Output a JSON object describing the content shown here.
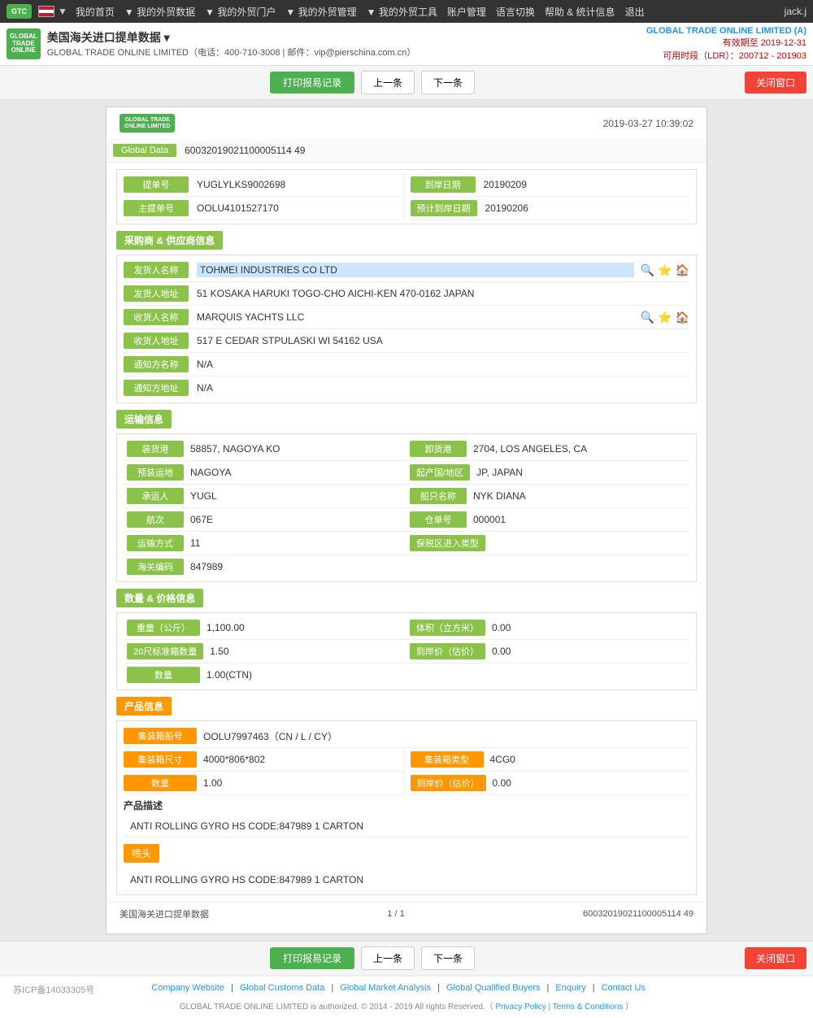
{
  "topNav": {
    "items": [
      "我的首页",
      "我的外贸数据",
      "我的外贸门户",
      "我的外贸管理",
      "我的外贸工具",
      "账户管理",
      "语言切换",
      "帮助 & 统计信息",
      "退出"
    ],
    "user": "jack.j",
    "flag": "US"
  },
  "header": {
    "title": "美国海关进口提单数据",
    "contact": "GLOBAL TRADE ONLINE LIMITED（电话：400-710-3008 | 邮件：vip@pierschina.com.cn）",
    "brand": "GLOBAL TRADE ONLINE LIMITED (A)",
    "validUntil": "有效期至 2019-12-31",
    "timeRange": "可用时段（LDR）：200712 - 201903"
  },
  "toolbar": {
    "print": "打印报易记录",
    "prev": "上一条",
    "next": "下一条",
    "close": "关闭窗口"
  },
  "record": {
    "timestamp": "2019-03-27 10:39:02",
    "globalData": {
      "label": "Global Data",
      "value": "60032019021100005114 49"
    },
    "billNo": {
      "label": "提单号",
      "value": "YUGLYLKS9002698"
    },
    "arrivalDate": {
      "label": "到岸日期",
      "value": "20190209"
    },
    "masterBillNo": {
      "label": "主提单号",
      "value": "OOLU4101527170"
    },
    "estimatedArrival": {
      "label": "预计到岸日期",
      "value": "20190206"
    }
  },
  "supplier": {
    "sectionTitle": "采购商 & 供应商信息",
    "shipper": {
      "label": "发货人名称",
      "value": "TOHMEI INDUSTRIES CO LTD"
    },
    "shipperAddr": {
      "label": "发货人地址",
      "value": "51 KOSAKA HARUKI TOGO-CHO AICHI-KEN 470-0162 JAPAN"
    },
    "consignee": {
      "label": "收货人名称",
      "value": "MARQUIS YACHTS LLC"
    },
    "consigneeAddr": {
      "label": "收货人地址",
      "value": "517 E CEDAR STPULASKI WI 54162 USA"
    },
    "notify": {
      "label": "通知方名称",
      "value": "N/A"
    },
    "notifyAddr": {
      "label": "通知方地址",
      "value": "N/A"
    }
  },
  "transport": {
    "sectionTitle": "运输信息",
    "loadPort": {
      "label": "装货港",
      "value": "58857, NAGOYA KO"
    },
    "dischargePort": {
      "label": "卸货港",
      "value": "2704, LOS ANGELES, CA"
    },
    "loadPlace": {
      "label": "预装运地",
      "value": "NAGOYA"
    },
    "originCountry": {
      "label": "起产国/地区",
      "value": "JP, JAPAN"
    },
    "carrier": {
      "label": "承运人",
      "value": "YUGL"
    },
    "vesselName": {
      "label": "船只名称",
      "value": "NYK DIANA"
    },
    "voyage": {
      "label": "航次",
      "value": "067E"
    },
    "billCount": {
      "label": "仓单号",
      "value": "000001"
    },
    "transportMode": {
      "label": "运输方式",
      "value": "11"
    },
    "bondedZone": {
      "label": "保税区进入类型",
      "value": ""
    },
    "customsCode": {
      "label": "海关编码",
      "value": "847989"
    }
  },
  "quantity": {
    "sectionTitle": "数量 & 价格信息",
    "weight": {
      "label": "重量（公斤）",
      "value": "1,100.00"
    },
    "volume": {
      "label": "体积（立方米）",
      "value": "0.00"
    },
    "containers20": {
      "label": "20尺标准箱数量",
      "value": "1.50"
    },
    "arrivalPrice": {
      "label": "到岸价（估价）",
      "value": "0.00"
    },
    "quantity": {
      "label": "数量",
      "value": "1.00(CTN)"
    }
  },
  "product": {
    "sectionTitle": "产品信息",
    "containerNo": {
      "label": "集装箱船号",
      "value": "OOLU7997463（CN / L / CY）"
    },
    "containerSize": {
      "label": "集装箱尺寸",
      "value": "4000*806*802"
    },
    "containerType": {
      "label": "集装箱类型",
      "value": "4CG0"
    },
    "quantityLabel": {
      "label": "数量",
      "value": "1.00"
    },
    "arrivalPrice": {
      "label": "到岸价（估价）",
      "value": "0.00"
    },
    "descTitle": "产品描述",
    "description": "ANTI ROLLING GYRO HS CODE:847989 1 CARTON",
    "headingLabel": "喷头",
    "headingDesc": "ANTI ROLLING GYRO HS CODE:847989 1 CARTON"
  },
  "cardFooter": {
    "source": "美国海关进口提单数据",
    "page": "1 / 1",
    "id": "60032019021100005114 49"
  },
  "footer": {
    "icp": "苏ICP备14033305号",
    "links": [
      "Company Website",
      "Global Customs Data",
      "Global Market Analysis",
      "Global Qualified Buyers",
      "Enquiry",
      "Contact Us"
    ],
    "copyright": "GLOBAL TRADE ONLINE LIMITED is authorized. © 2014 - 2019 All rights Reserved.（",
    "privacy": "Privacy Policy",
    "terms": "Terms & Conditions",
    "copyrightEnd": "）"
  }
}
